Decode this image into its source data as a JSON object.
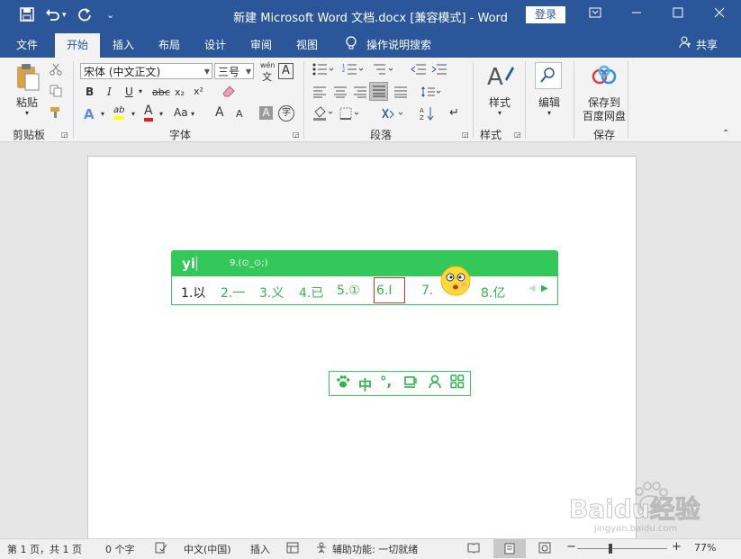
{
  "title_bar": {
    "save_icon": "save-icon",
    "undo_icon": "undo-icon",
    "redo_icon": "redo-icon",
    "customize_icon": "customize-quick-access-icon",
    "document_title": "新建 Microsoft Word 文档.docx [兼容模式]  -  Word",
    "login_label": "登录",
    "colors": {
      "background": "#2b579a"
    }
  },
  "tabs": {
    "file": "文件",
    "home": "开始",
    "insert": "插入",
    "layout": "布局",
    "design": "设计",
    "review": "审阅",
    "view": "视图",
    "tell_me": "操作说明搜索",
    "share": "共享"
  },
  "ribbon": {
    "clipboard": {
      "paste_label": "粘贴",
      "group_label": "剪贴板"
    },
    "font": {
      "font_name": "宋体 (中文正文)",
      "font_size": "三号",
      "pinyin_top": "wén",
      "pinyin_bottom": "文",
      "char_border": "A",
      "bold": "B",
      "italic": "I",
      "underline": "U",
      "strikethrough": "abc",
      "subscript": "x₂",
      "superscript": "x²",
      "text_effects": "A",
      "highlight": "ab",
      "font_color": "A",
      "change_case": "Aa",
      "grow_font": "A",
      "shrink_font": "A",
      "char_shading": "A",
      "enclose": "字",
      "group_label": "字体"
    },
    "paragraph": {
      "group_label": "段落"
    },
    "styles": {
      "label": "样式",
      "group_label": "样式"
    },
    "editing": {
      "label": "编辑"
    },
    "save": {
      "label_line1": "保存到",
      "label_line2": "百度网盘",
      "group_label": "保存"
    }
  },
  "ime": {
    "input": "yi",
    "hint": "9.(⊙_⊙;)",
    "candidates": [
      "1.以",
      "2.一",
      "3.义",
      "4.已",
      "5.①",
      "6.Ⅰ",
      "7.",
      "8.亿"
    ],
    "selected_index": 5,
    "colors": {
      "accent": "#34c85a",
      "selected_border": "#c0392b"
    }
  },
  "ime_toolbar": {
    "paw_icon": "paw-icon",
    "lang": "中",
    "punct": "°,",
    "cup_icon": "cup-icon",
    "user_icon": "user-icon",
    "grid_icon": "grid-icon"
  },
  "status_bar": {
    "page": "第 1 页，共 1 页",
    "words": "0 个字",
    "language": "中文(中国)",
    "insert_mode": "插入",
    "accessibility": "辅助功能: 一切就绪",
    "zoom_minus": "−",
    "zoom_plus": "+",
    "zoom": "77%",
    "zoom_level": 0.77
  },
  "watermark": {
    "brand": "Baidu经验",
    "url": "jingyan.baidu.com"
  }
}
